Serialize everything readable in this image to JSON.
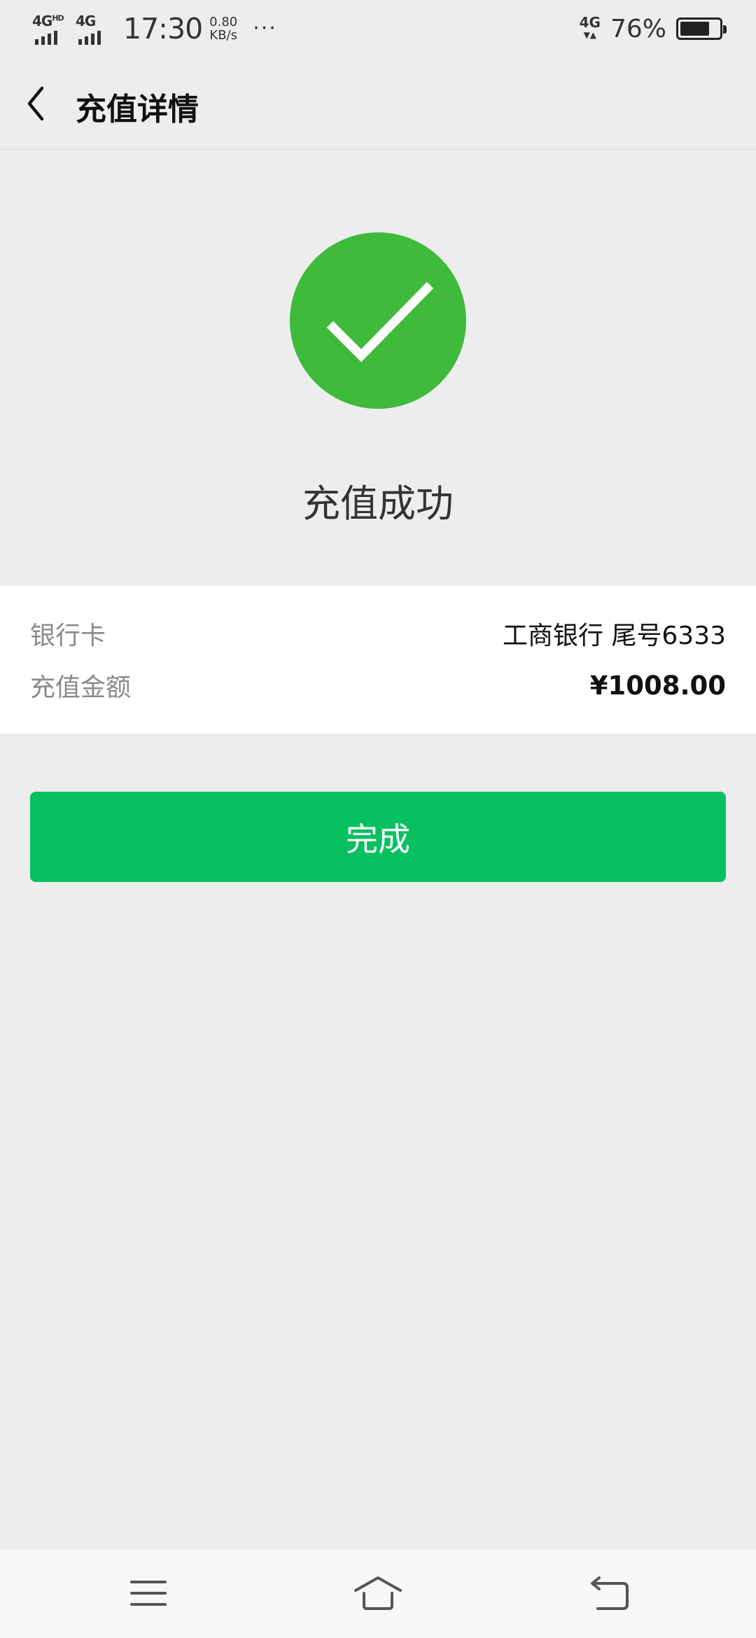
{
  "status_bar": {
    "signal1_label": "4G",
    "signal1_sup": "HD",
    "signal2_label": "4G",
    "time": "17:30",
    "net_speed_value": "0.80",
    "net_speed_unit": "KB/s",
    "more": "···",
    "net_type": "4G",
    "battery_percent": "76%",
    "battery_level": 0.76
  },
  "header": {
    "back_icon": "chevron-left-icon",
    "title": "充值详情"
  },
  "result": {
    "icon": "check-circle-icon",
    "icon_color": "#3fba3a",
    "message": "充值成功"
  },
  "details": [
    {
      "label": "银行卡",
      "value": "工商银行 尾号6333"
    },
    {
      "label": "充值金额",
      "value": "¥1008.00"
    }
  ],
  "actions": {
    "done_label": "完成",
    "done_color": "#07c160"
  },
  "system_nav": {
    "menu_icon": "menu-icon",
    "home_icon": "home-icon",
    "back_icon": "back-icon"
  }
}
